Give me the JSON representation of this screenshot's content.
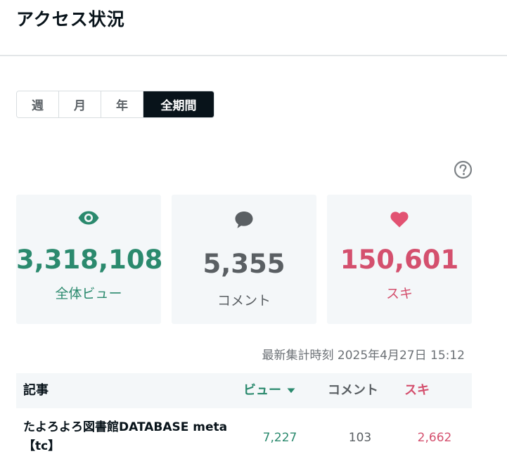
{
  "header": {
    "title": "アクセス状況"
  },
  "period_tabs": [
    {
      "label": "週",
      "active": false
    },
    {
      "label": "月",
      "active": false
    },
    {
      "label": "年",
      "active": false
    },
    {
      "label": "全期間",
      "active": true
    }
  ],
  "help": {
    "icon": "question-circle-icon"
  },
  "stats": {
    "views": {
      "icon": "eye-icon",
      "value": "3,318,108",
      "label": "全体ビュー",
      "color": "#2b8a6e"
    },
    "comments": {
      "icon": "speech-bubble-icon",
      "value": "5,355",
      "label": "コメント",
      "color": "#5a5f63"
    },
    "likes": {
      "icon": "heart-icon",
      "value": "150,601",
      "label": "スキ",
      "color": "#d4506e"
    }
  },
  "updated_at": "最新集計時刻 2025年4月27日 15:12",
  "table": {
    "headers": {
      "article": "記事",
      "views": "ビュー",
      "comments": "コメント",
      "likes": "スキ"
    },
    "sort_icon": "caret-down-icon",
    "rows": [
      {
        "title": "たよろよろ図書館DATABASE meta【tc】",
        "views": "7,227",
        "comments": "103",
        "likes": "2,662"
      }
    ]
  }
}
